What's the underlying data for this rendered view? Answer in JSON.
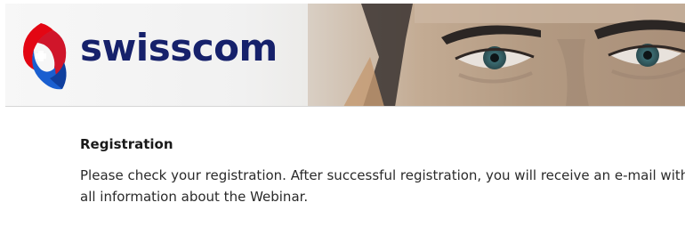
{
  "header": {
    "brand_name": "swisscom",
    "brand_color": "#16216b",
    "logo_colors": [
      "#e30613",
      "#1a5fd0"
    ],
    "logo_icon": "swisscom-ribbon-logo"
  },
  "content": {
    "heading": "Registration",
    "message": "Please check your registration. After successful registration, you will receive an e-mail with all information about the Webinar."
  }
}
